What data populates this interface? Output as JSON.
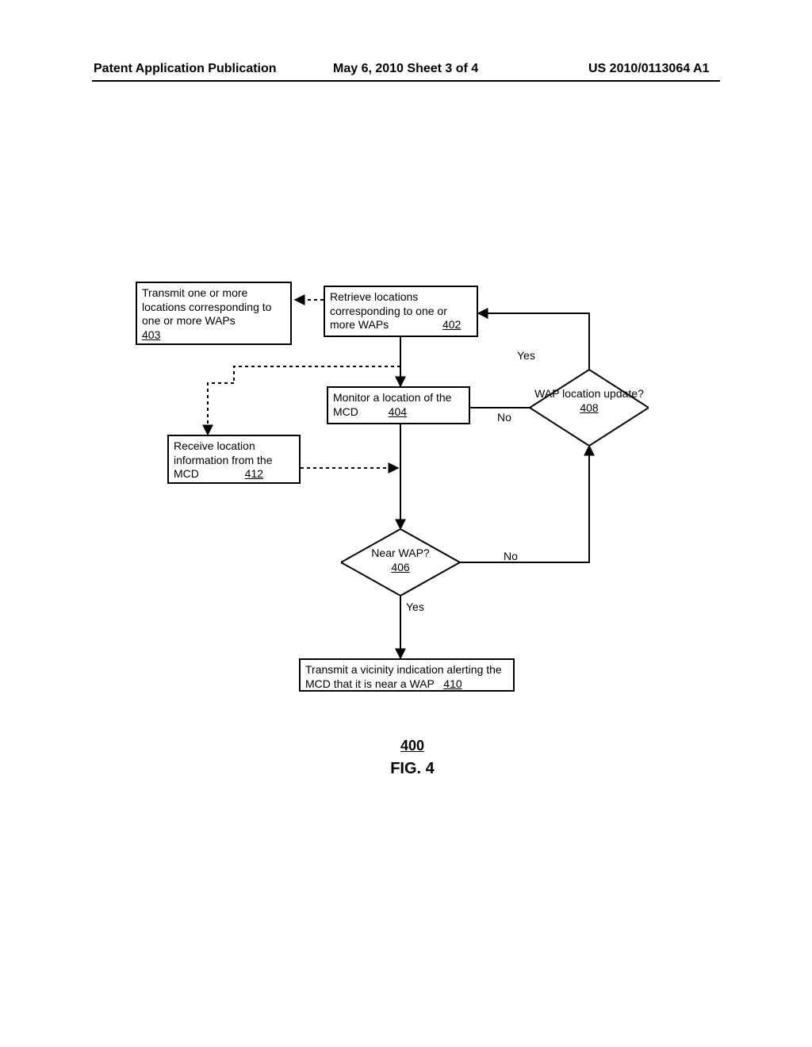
{
  "header": {
    "left": "Patent Application Publication",
    "center": "May 6, 2010  Sheet 3 of 4",
    "right": "US 2010/0113064 A1"
  },
  "boxes": {
    "b403": {
      "text": "Transmit one or more locations corresponding to one or more WAPs",
      "ref": "403"
    },
    "b402": {
      "text": "Retrieve locations corresponding to one or more WAPs",
      "ref": "402"
    },
    "b404": {
      "text": "Monitor a location of the MCD",
      "ref": "404"
    },
    "b412": {
      "text": "Receive location information from the MCD",
      "ref": "412"
    },
    "b410": {
      "text": "Transmit a vicinity indication alerting the MCD that it is near a WAP",
      "ref": "410"
    }
  },
  "diamonds": {
    "d406": {
      "text": "Near WAP?",
      "ref": "406"
    },
    "d408": {
      "text": "WAP location update?",
      "ref": "408"
    }
  },
  "labels": {
    "yes": "Yes",
    "no": "No"
  },
  "figure": {
    "num": "400",
    "label": "FIG. 4"
  },
  "chart_data": {
    "type": "flowchart",
    "title": "FIG. 4",
    "figure_ref": "400",
    "nodes": [
      {
        "id": "403",
        "type": "process",
        "label": "Transmit one or more locations corresponding to one or more WAPs"
      },
      {
        "id": "402",
        "type": "process",
        "label": "Retrieve locations corresponding to one or more WAPs"
      },
      {
        "id": "404",
        "type": "process",
        "label": "Monitor a location of the MCD"
      },
      {
        "id": "412",
        "type": "process",
        "label": "Receive location information from the MCD"
      },
      {
        "id": "406",
        "type": "decision",
        "label": "Near WAP?"
      },
      {
        "id": "408",
        "type": "decision",
        "label": "WAP location update?"
      },
      {
        "id": "410",
        "type": "process",
        "label": "Transmit a vicinity indication alerting the MCD that it is near a WAP"
      }
    ],
    "edges": [
      {
        "from": "402",
        "to": "403",
        "style": "dashed"
      },
      {
        "from": "402",
        "to": "404",
        "style": "solid"
      },
      {
        "from": "404",
        "to": "406",
        "style": "solid"
      },
      {
        "from": "406",
        "to": "410",
        "label": "Yes",
        "style": "solid"
      },
      {
        "from": "406",
        "to": "408",
        "label": "No",
        "style": "solid"
      },
      {
        "from": "408",
        "to": "402",
        "label": "Yes",
        "style": "solid"
      },
      {
        "from": "404",
        "to": "408",
        "label": "No",
        "style": "solid"
      },
      {
        "from": "404",
        "to": "412",
        "style": "dashed"
      },
      {
        "from": "412",
        "to": "404",
        "style": "dashed"
      }
    ]
  }
}
